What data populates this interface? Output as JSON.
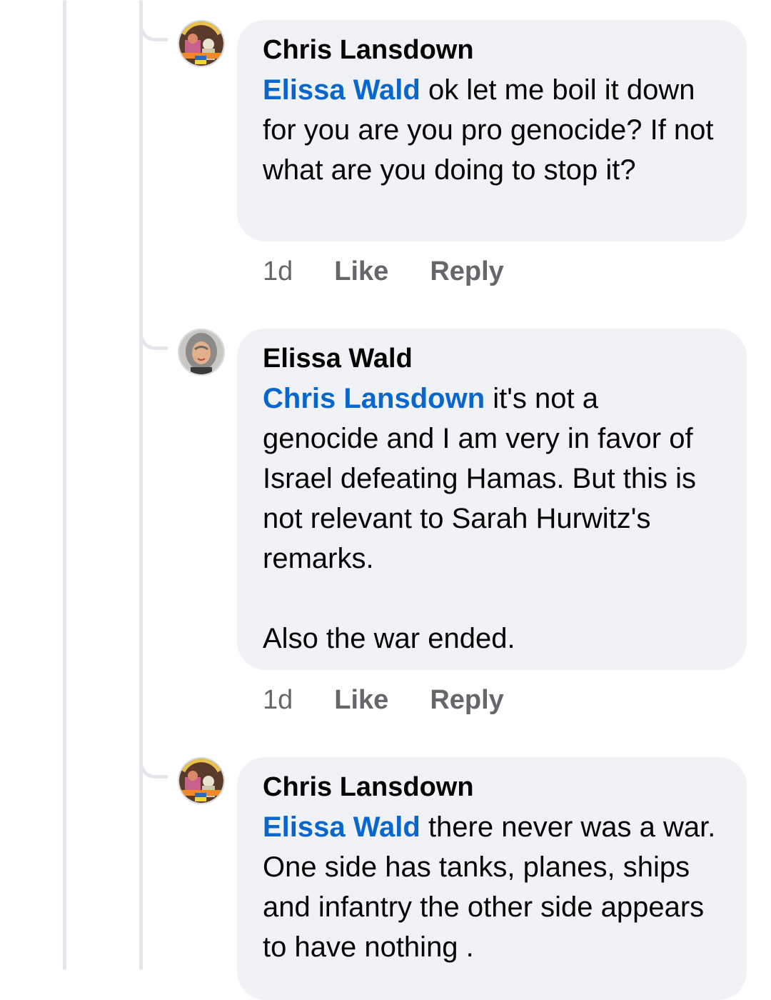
{
  "comments": [
    {
      "author": "Chris Lansdown",
      "mention": "Elissa Wald",
      "text": " ok let me boil it down for you are you pro genocide? If not what are you doing to stop it?",
      "time": "1d",
      "like_label": "Like",
      "reply_label": "Reply",
      "avatar": "protest-sign-avatar"
    },
    {
      "author": "Elissa Wald",
      "mention": "Chris Lansdown",
      "text": " it's not a genocide and I am very in favor of Israel defeating Hamas. But this is not relevant to Sarah Hurwitz's remarks.\n\nAlso the war ended.",
      "time": "1d",
      "like_label": "Like",
      "reply_label": "Reply",
      "avatar": "woman-portrait-avatar"
    },
    {
      "author": "Chris Lansdown",
      "mention": "Elissa Wald",
      "text": " there never was a war. One side has tanks, planes, ships and infantry  the other side appears to have nothing .",
      "avatar": "protest-sign-avatar"
    }
  ],
  "colors": {
    "mention": "#0866cc",
    "bubble": "#f0f2f5",
    "meta": "#65676b",
    "thread_line": "#e4e6eb"
  }
}
